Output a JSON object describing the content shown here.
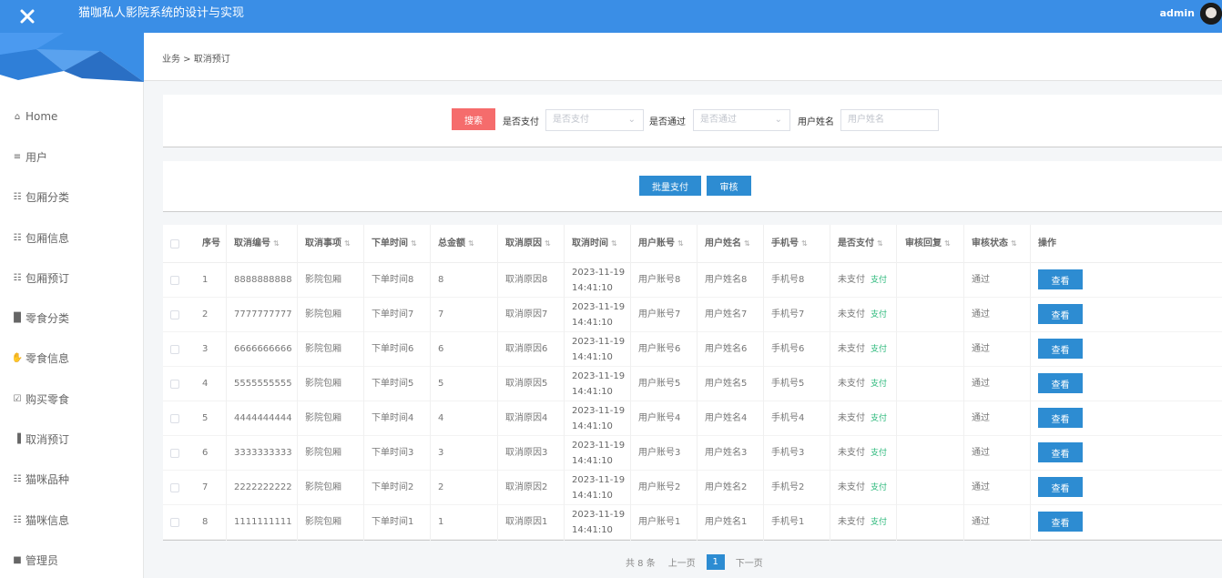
{
  "header": {
    "title": "猫咖私人影院系统的设计与实现",
    "user": "admin",
    "accent_color": "#3a8ee6"
  },
  "sidebar": {
    "items": [
      {
        "label": "Home",
        "icon": "home-icon"
      },
      {
        "label": "用户",
        "icon": "list-icon"
      },
      {
        "label": "包厢分类",
        "icon": "grid-icon"
      },
      {
        "label": "包厢信息",
        "icon": "grid-icon"
      },
      {
        "label": "包厢预订",
        "icon": "grid-icon"
      },
      {
        "label": "零食分类",
        "icon": "chart-bar-icon"
      },
      {
        "label": "零食信息",
        "icon": "thumb-icon"
      },
      {
        "label": "购买零食",
        "icon": "clipboard-icon"
      },
      {
        "label": "取消预订",
        "icon": "bar-chart-icon"
      },
      {
        "label": "猫咪品种",
        "icon": "grid-icon"
      },
      {
        "label": "猫咪信息",
        "icon": "grid-icon"
      },
      {
        "label": "管理员",
        "icon": "monitor-icon"
      }
    ]
  },
  "breadcrumb": "业务 > 取消预订",
  "search": {
    "button_label": "搜索",
    "paid_label": "是否支付",
    "paid_placeholder": "是否支付",
    "approved_label": "是否通过",
    "approved_placeholder": "是否通过",
    "username_label": "用户姓名",
    "username_placeholder": "用户姓名"
  },
  "actions": {
    "batch_pay_label": "批量支付",
    "review_label": "审核"
  },
  "table": {
    "columns": [
      "序号",
      "取消编号",
      "取消事项",
      "下单时间",
      "总金额",
      "取消原因",
      "取消时间",
      "用户账号",
      "用户姓名",
      "手机号",
      "是否支付",
      "审核回复",
      "审核状态",
      "操作"
    ],
    "rows": [
      {
        "index": "1",
        "cancel_no": "8888888888",
        "item": "影院包厢",
        "order_time": "下单时间8",
        "amount": "8",
        "reason": "取消原因8",
        "cancel_date": "2023-11-19",
        "cancel_clock": "14:41:10",
        "account": "用户账号8",
        "name": "用户姓名8",
        "phone": "手机号8",
        "paid": "未支付",
        "pay_link": "支付",
        "reply": "",
        "status": "通过",
        "view": "查看"
      },
      {
        "index": "2",
        "cancel_no": "7777777777",
        "item": "影院包厢",
        "order_time": "下单时间7",
        "amount": "7",
        "reason": "取消原因7",
        "cancel_date": "2023-11-19",
        "cancel_clock": "14:41:10",
        "account": "用户账号7",
        "name": "用户姓名7",
        "phone": "手机号7",
        "paid": "未支付",
        "pay_link": "支付",
        "reply": "",
        "status": "通过",
        "view": "查看"
      },
      {
        "index": "3",
        "cancel_no": "6666666666",
        "item": "影院包厢",
        "order_time": "下单时间6",
        "amount": "6",
        "reason": "取消原因6",
        "cancel_date": "2023-11-19",
        "cancel_clock": "14:41:10",
        "account": "用户账号6",
        "name": "用户姓名6",
        "phone": "手机号6",
        "paid": "未支付",
        "pay_link": "支付",
        "reply": "",
        "status": "通过",
        "view": "查看"
      },
      {
        "index": "4",
        "cancel_no": "5555555555",
        "item": "影院包厢",
        "order_time": "下单时间5",
        "amount": "5",
        "reason": "取消原因5",
        "cancel_date": "2023-11-19",
        "cancel_clock": "14:41:10",
        "account": "用户账号5",
        "name": "用户姓名5",
        "phone": "手机号5",
        "paid": "未支付",
        "pay_link": "支付",
        "reply": "",
        "status": "通过",
        "view": "查看"
      },
      {
        "index": "5",
        "cancel_no": "4444444444",
        "item": "影院包厢",
        "order_time": "下单时间4",
        "amount": "4",
        "reason": "取消原因4",
        "cancel_date": "2023-11-19",
        "cancel_clock": "14:41:10",
        "account": "用户账号4",
        "name": "用户姓名4",
        "phone": "手机号4",
        "paid": "未支付",
        "pay_link": "支付",
        "reply": "",
        "status": "通过",
        "view": "查看"
      },
      {
        "index": "6",
        "cancel_no": "3333333333",
        "item": "影院包厢",
        "order_time": "下单时间3",
        "amount": "3",
        "reason": "取消原因3",
        "cancel_date": "2023-11-19",
        "cancel_clock": "14:41:10",
        "account": "用户账号3",
        "name": "用户姓名3",
        "phone": "手机号3",
        "paid": "未支付",
        "pay_link": "支付",
        "reply": "",
        "status": "通过",
        "view": "查看"
      },
      {
        "index": "7",
        "cancel_no": "2222222222",
        "item": "影院包厢",
        "order_time": "下单时间2",
        "amount": "2",
        "reason": "取消原因2",
        "cancel_date": "2023-11-19",
        "cancel_clock": "14:41:10",
        "account": "用户账号2",
        "name": "用户姓名2",
        "phone": "手机号2",
        "paid": "未支付",
        "pay_link": "支付",
        "reply": "",
        "status": "通过",
        "view": "查看"
      },
      {
        "index": "8",
        "cancel_no": "1111111111",
        "item": "影院包厢",
        "order_time": "下单时间1",
        "amount": "1",
        "reason": "取消原因1",
        "cancel_date": "2023-11-19",
        "cancel_clock": "14:41:10",
        "account": "用户账号1",
        "name": "用户姓名1",
        "phone": "手机号1",
        "paid": "未支付",
        "pay_link": "支付",
        "reply": "",
        "status": "通过",
        "view": "查看"
      }
    ]
  },
  "pagination": {
    "total": "共 8 条",
    "prev": "上一页",
    "current": "1",
    "next": "下一页"
  }
}
